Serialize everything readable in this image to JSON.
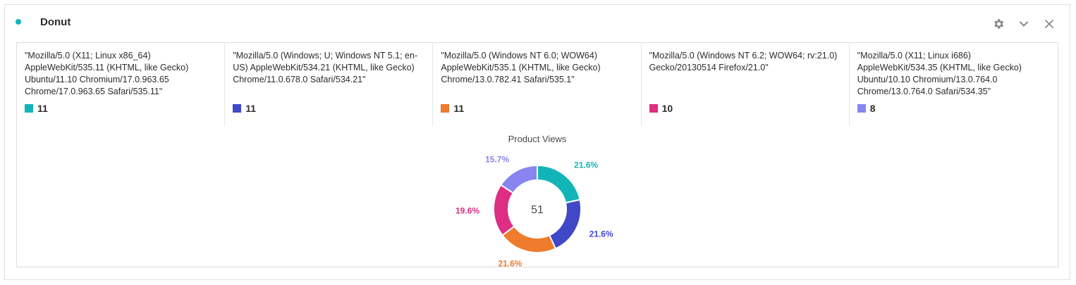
{
  "panel": {
    "title": "Donut",
    "status_color": "#12b5b7",
    "actions": [
      {
        "name": "settings",
        "icon": "gear-icon"
      },
      {
        "name": "collapse",
        "icon": "chevron-down-icon"
      },
      {
        "name": "close",
        "icon": "close-icon"
      }
    ]
  },
  "chart_data": {
    "type": "pie",
    "donut": true,
    "title": "Product Views",
    "total_label": "51",
    "series": [
      {
        "name": "\"Mozilla/5.0 (X11; Linux x86_64) AppleWebKit/535.11 (KHTML, like Gecko) Ubuntu/11.10 Chromium/17.0.963.65 Chrome/17.0.963.65 Safari/535.11\"",
        "value": 11,
        "value_label": "11",
        "percent_label": "21.6%",
        "color": "#12b5b7"
      },
      {
        "name": "\"Mozilla/5.0 (Windows; U; Windows NT 5.1; en-US) AppleWebKit/534.21 (KHTML, like Gecko) Chrome/11.0.678.0 Safari/534.21\"",
        "value": 11,
        "value_label": "11",
        "percent_label": "21.6%",
        "color": "#4148c8"
      },
      {
        "name": "\"Mozilla/5.0 (Windows NT 6.0; WOW64) AppleWebKit/535.1 (KHTML, like Gecko) Chrome/13.0.782.41 Safari/535.1\"",
        "value": 11,
        "value_label": "11",
        "percent_label": "21.6%",
        "color": "#ef7b2c"
      },
      {
        "name": "\"Mozilla/5.0 (Windows NT 6.2; WOW64; rv:21.0) Gecko/20130514 Firefox/21.0\"",
        "value": 10,
        "value_label": "10",
        "percent_label": "19.6%",
        "color": "#dd2e84"
      },
      {
        "name": "\"Mozilla/5.0 (X11; Linux i686) AppleWebKit/534.35 (KHTML, like Gecko) Ubuntu/10.10 Chromium/13.0.764.0 Chrome/13.0.764.0 Safari/534.35\"",
        "value": 8,
        "value_label": "8",
        "percent_label": "15.7%",
        "color": "#8985f0"
      }
    ]
  }
}
